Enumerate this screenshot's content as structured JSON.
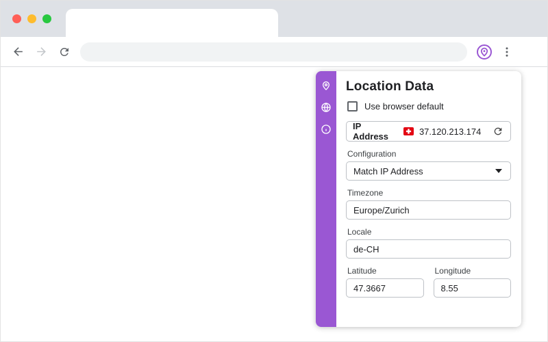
{
  "colors": {
    "accent": "#9a57d3",
    "chrome_bg": "#dee1e6",
    "field_border": "#bdc1c6",
    "flag_red": "#e30613"
  },
  "browser": {
    "address_value": "",
    "icons": {
      "back": "arrow-left",
      "forward": "arrow-right",
      "reload": "circular-arrow",
      "extension": "purple-location-logo",
      "menu": "vertical-dots"
    }
  },
  "panel": {
    "title": "Location Data",
    "checkbox_label": "Use browser default",
    "checkbox_checked": false,
    "sidebar_icons": [
      {
        "name": "location-pin"
      },
      {
        "name": "globe"
      },
      {
        "name": "info"
      }
    ],
    "ip": {
      "label": "IP Address",
      "value": "37.120.213.174",
      "flag": "swiss-flag",
      "refresh_icon": "circular-arrow"
    },
    "fields": {
      "configuration": {
        "label": "Configuration",
        "value": "Match IP Address"
      },
      "timezone": {
        "label": "Timezone",
        "value": "Europe/Zurich"
      },
      "locale": {
        "label": "Locale",
        "value": "de-CH"
      },
      "latitude": {
        "label": "Latitude",
        "value": "47.3667"
      },
      "longitude": {
        "label": "Longitude",
        "value": "8.55"
      }
    }
  }
}
